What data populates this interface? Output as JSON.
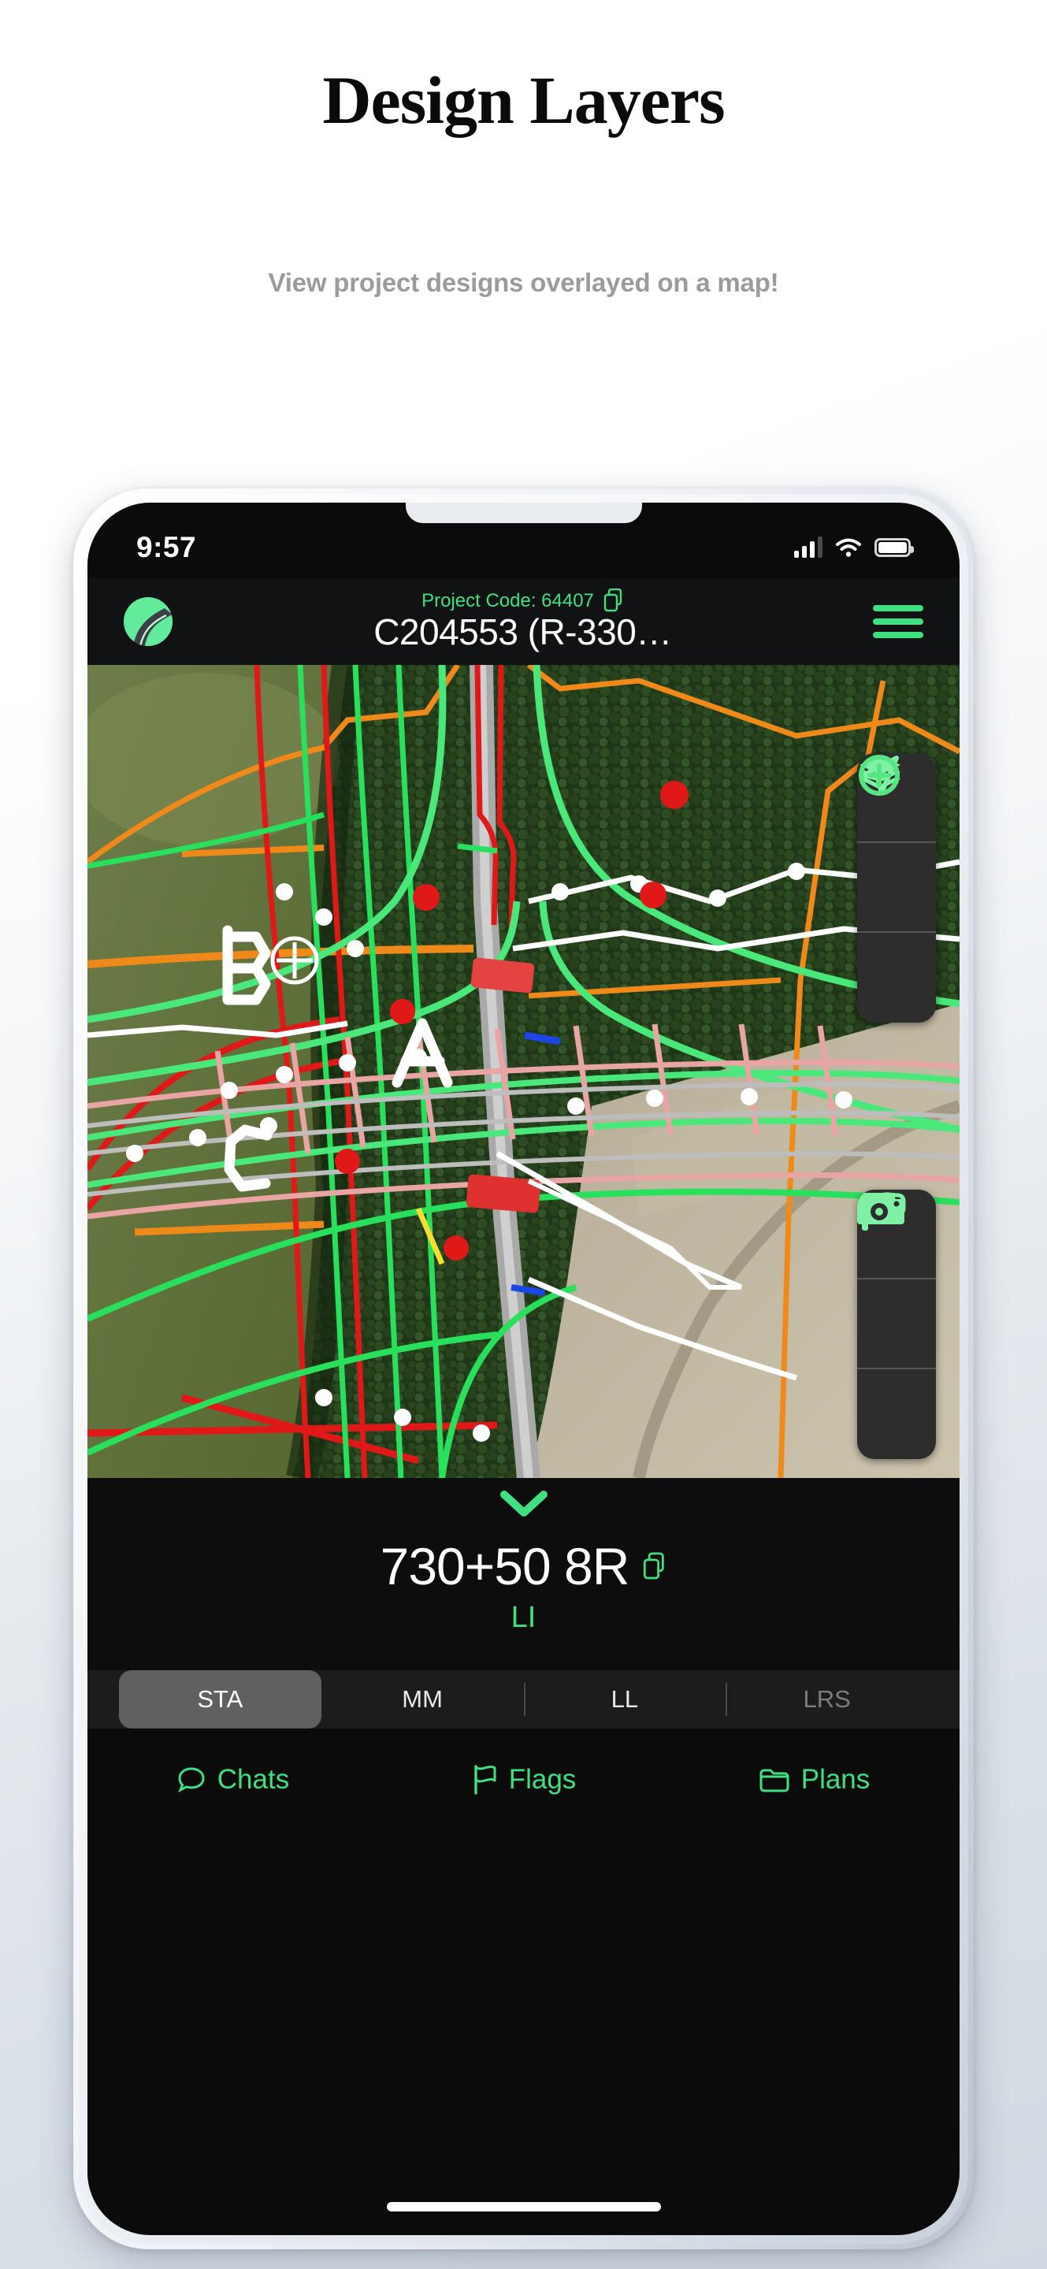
{
  "page": {
    "headline": "Design Layers",
    "subhead": "View project designs overlayed on a map!"
  },
  "statusbar": {
    "time": "9:57",
    "signal_icon": "cellular-signal-icon",
    "wifi_icon": "wifi-icon",
    "battery_icon": "battery-icon"
  },
  "appbar": {
    "logo_icon": "app-logo-road-icon",
    "project_code_label": "Project Code: 64407",
    "copy_icon": "copy-icon",
    "project_title": "C204553 (R-330…",
    "menu_icon": "hamburger-menu-icon"
  },
  "map": {
    "controls_top": [
      {
        "icon": "layers-icon",
        "name": "map-layers-button"
      },
      {
        "icon": "navigate-icon",
        "name": "locate-me-button"
      },
      {
        "icon": "plus-circle-icon",
        "name": "add-point-button"
      }
    ],
    "controls_bottom": [
      {
        "icon": "ruler-icon",
        "name": "measure-button"
      },
      {
        "icon": "flag-icon",
        "name": "place-flag-button"
      },
      {
        "icon": "camera-icon",
        "name": "camera-button"
      }
    ],
    "annotations": [
      "A",
      "B",
      "C"
    ],
    "crosshair_icon": "crosshair-target-icon"
  },
  "info_panel": {
    "collapse_icon": "chevron-down-icon",
    "station": "730+50 8R",
    "copy_icon": "copy-icon",
    "sub_label": "LI"
  },
  "segmented": {
    "items": [
      {
        "label": "STA",
        "selected": true,
        "dim": false
      },
      {
        "label": "MM",
        "selected": false,
        "dim": false
      },
      {
        "label": "LL",
        "selected": false,
        "dim": false
      },
      {
        "label": "LRS",
        "selected": false,
        "dim": true
      }
    ]
  },
  "bottom_nav": {
    "items": [
      {
        "label": "Chats",
        "icon": "chat-bubble-icon"
      },
      {
        "label": "Flags",
        "icon": "flag-outline-icon"
      },
      {
        "label": "Plans",
        "icon": "folder-icon"
      }
    ]
  },
  "colors": {
    "accent_green": "#3ee07f",
    "logo_green": "#62eb9a",
    "panel_black": "#0d0d0d",
    "selected_tab": "#606060",
    "headline": "#0b0b0b",
    "subhead": "#9b9b9b"
  }
}
